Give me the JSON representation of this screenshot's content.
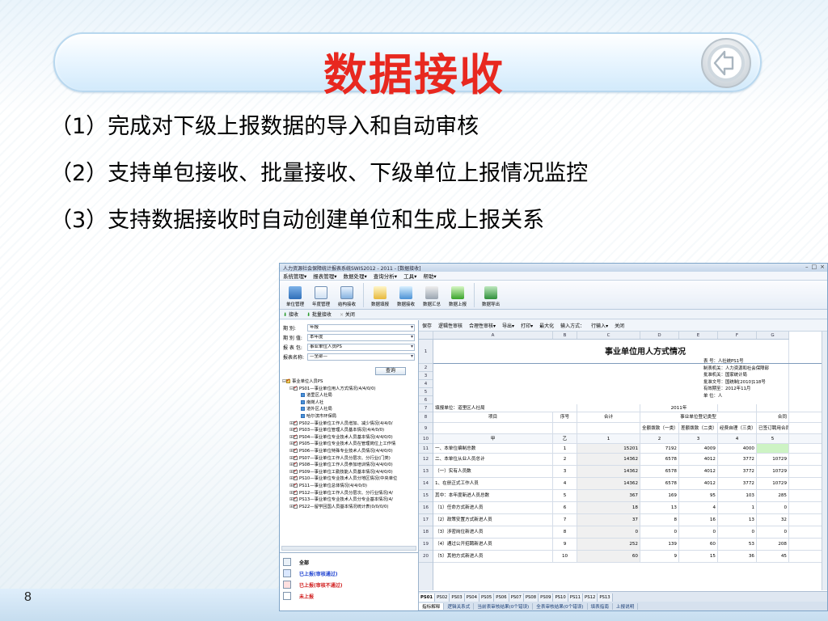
{
  "slide": {
    "title": "数据接收",
    "bullets": [
      "（1）完成对下级上报数据的导入和自动审核",
      "（2）支持单包接收、批量接收、下级单位上报情况监控",
      "（3）支持数据接收时自动创建单位和生成上报关系"
    ],
    "page_number": "8",
    "title_color": "#e8281f"
  },
  "app": {
    "window_title": "人力资源社会保障统计报表系统SWIS2012 - 2011 - [数据接收]",
    "menu": [
      "系统管理▾",
      "报表管理▾",
      "数据处理▾",
      "查询分析▾",
      "工具▾",
      "帮助▾"
    ],
    "ribbon": [
      "单位管理",
      "年度管理",
      "结构接收",
      "数据填报",
      "数据接收",
      "数据汇总",
      "数据上报",
      "数据导出"
    ],
    "subbar": [
      "接收",
      "批量接收",
      "关闭"
    ],
    "params": [
      {
        "label": "期    别:",
        "value": "年报"
      },
      {
        "label": "期 别 值:",
        "value": "本年度"
      },
      {
        "label": "报 表 包:",
        "value": "事业单位人员PS"
      },
      {
        "label": "报表名称:",
        "value": "—全部—"
      }
    ],
    "query_button": "查询",
    "tree": [
      {
        "indent": 0,
        "toggle": "⊟",
        "text": "事业单位人员PS"
      },
      {
        "indent": 1,
        "toggle": "⊟",
        "text": "PS01—事业单位用人方式情况(4/4/0/0)"
      },
      {
        "indent": 2,
        "toggle": "",
        "text": "道里区人社局"
      },
      {
        "indent": 2,
        "toggle": "",
        "text": "南岗人社"
      },
      {
        "indent": 2,
        "toggle": "",
        "text": "道外区人社局"
      },
      {
        "indent": 2,
        "toggle": "",
        "text": "哈尔滨市环保局"
      },
      {
        "indent": 1,
        "toggle": "⊞",
        "text": "PS02—事业单位工作人员增加、减少情况(4/4/0/"
      },
      {
        "indent": 1,
        "toggle": "⊞",
        "text": "PS03—事业单位管理人员基本情况(4/4/0/0)"
      },
      {
        "indent": 1,
        "toggle": "⊞",
        "text": "PS04—事业单位专业技术人员基本情况(4/4/0/0)"
      },
      {
        "indent": 1,
        "toggle": "⊞",
        "text": "PS05—事业单位专业技术人员在管理岗位上工作情"
      },
      {
        "indent": 1,
        "toggle": "⊞",
        "text": "PS06—事业单位特殊专业技术人员情况(4/4/0/0)"
      },
      {
        "indent": 1,
        "toggle": "⊞",
        "text": "PS07—事业单位工作人员分层次、分行业(门类)"
      },
      {
        "indent": 1,
        "toggle": "⊞",
        "text": "PS08—事业单位工作人员参加培训情况(4/4/0/0)"
      },
      {
        "indent": 1,
        "toggle": "⊞",
        "text": "PS09—事业单位工勤技能人员基本情况(4/4/0/0)"
      },
      {
        "indent": 1,
        "toggle": "⊞",
        "text": "PS10—事业单位专业技术人员分地区情况(中央单位"
      },
      {
        "indent": 1,
        "toggle": "⊞",
        "text": "PS11—事业单位总体情况(4/4/0/0)"
      },
      {
        "indent": 1,
        "toggle": "⊞",
        "text": "PS12—事业单位工作人员分层次、分行业情况(4/"
      },
      {
        "indent": 1,
        "toggle": "⊞",
        "text": "PS13—事业单位专业技术人员分专业基本情况(4/"
      },
      {
        "indent": 1,
        "toggle": "⊞",
        "text": "PS22—留学回国人员基本情况统计表(0/0/0/0)"
      }
    ],
    "legend": [
      {
        "text": "全部",
        "color": "#000000"
      },
      {
        "text": "已上报(审核通过)",
        "color": "#1a3fd0"
      },
      {
        "text": "已上报(审核不通过)",
        "color": "#d01a1a"
      },
      {
        "text": "未上报",
        "color": "#d01a1a"
      }
    ],
    "toolbar2": [
      "保存",
      "逻辑性审核",
      "合理性审核▾",
      "导出▾",
      "打印▾",
      "最大化",
      "输入方式：",
      "行输入▾",
      "关闭"
    ],
    "columns": [
      "A",
      "B",
      "C",
      "D",
      "E",
      "F",
      "G"
    ],
    "sheet": {
      "title": "事业单位用人方式情况",
      "meta": [
        "表    号：人社统PS1号",
        "制表机关：人力资源和社会保障部",
        "批准机关：国家统计局",
        "批准文号：国统制[2010]118号",
        "有效期至：2012年11月",
        "单    位：人"
      ],
      "unit_label": "填报单位：道里区人社局",
      "year": "2011年",
      "group_header": "事业单位登记类型",
      "group_header_right": "合同",
      "head": {
        "item": "项目",
        "seq": "序号",
        "total": "合计",
        "c1": "全额拨款（一类）",
        "c2": "差额拨款（二类）",
        "c3": "经费自理（三类）",
        "c4": "已签订聘用合同",
        "c5": "已签"
      },
      "code_row": {
        "item": "甲",
        "seq": "乙",
        "total": "1",
        "c1": "2",
        "c2": "3",
        "c3": "4",
        "c4": "5"
      },
      "rows": [
        {
          "item": "一、本单位编制总数",
          "seq": "1",
          "total": "15201",
          "c1": "7192",
          "c2": "4009",
          "c3": "4000",
          "c4": ""
        },
        {
          "item": "二、本单位从业人员总计",
          "seq": "2",
          "total": "14362",
          "c1": "6578",
          "c2": "4012",
          "c3": "3772",
          "c4": "10729"
        },
        {
          "item": "（一）实有人员数",
          "seq": "3",
          "total": "14362",
          "c1": "6578",
          "c2": "4012",
          "c3": "3772",
          "c4": "10729"
        },
        {
          "item": "1、在册正式工作人员",
          "seq": "4",
          "total": "14362",
          "c1": "6578",
          "c2": "4012",
          "c3": "3772",
          "c4": "10729"
        },
        {
          "item": "其中：本年度新进人员总数",
          "seq": "5",
          "total": "367",
          "c1": "169",
          "c2": "95",
          "c3": "103",
          "c4": "285"
        },
        {
          "item": "（1）任命方式新进人员",
          "seq": "6",
          "total": "18",
          "c1": "13",
          "c2": "4",
          "c3": "1",
          "c4": "0"
        },
        {
          "item": "（2）政策安置方式新进人员",
          "seq": "7",
          "total": "37",
          "c1": "8",
          "c2": "16",
          "c3": "13",
          "c4": "32"
        },
        {
          "item": "（3）涉密岗位新进人员",
          "seq": "8",
          "total": "0",
          "c1": "0",
          "c2": "0",
          "c3": "0",
          "c4": "0"
        },
        {
          "item": "（4）通过公开招聘新进人员",
          "seq": "9",
          "total": "252",
          "c1": "139",
          "c2": "60",
          "c3": "53",
          "c4": "208"
        },
        {
          "item": "（5）其他方式新进人员",
          "seq": "10",
          "total": "60",
          "c1": "9",
          "c2": "15",
          "c3": "36",
          "c4": "45"
        }
      ],
      "row_numbers": [
        "1",
        "2",
        "3",
        "4",
        "5",
        "6",
        "7",
        "8",
        "9",
        "10",
        "11",
        "12",
        "13",
        "14",
        "15",
        "16",
        "17",
        "18",
        "19",
        "20"
      ]
    },
    "sheet_tabs": [
      "PS01",
      "PS02",
      "PS03",
      "PS04",
      "PS05",
      "PS06",
      "PS07",
      "PS08",
      "PS09",
      "PS10",
      "PS11",
      "PS12",
      "PS13"
    ],
    "status_tabs": [
      "指标解释",
      "逻辑关系式",
      "当前表审核结果(0个错误)",
      "全表审核结果(0个错误)",
      "填表指南",
      "上报说明"
    ]
  }
}
